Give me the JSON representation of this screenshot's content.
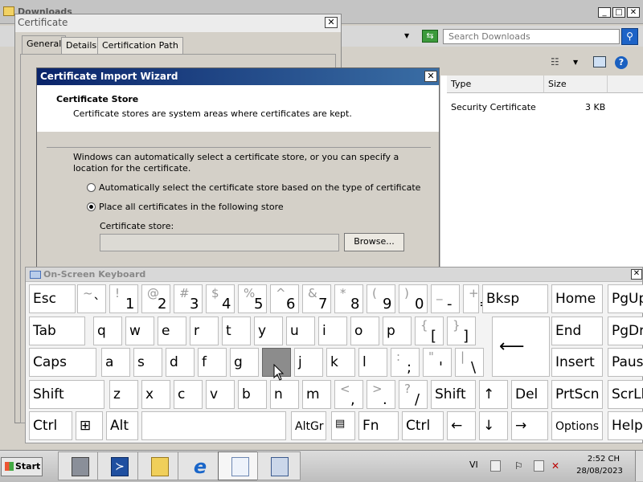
{
  "explorer": {
    "title": "Downloads",
    "search_placeholder": "Search Downloads",
    "columns": [
      "Type",
      "Size"
    ],
    "files": [
      {
        "type": "Security Certificate",
        "size": "3 KB"
      }
    ]
  },
  "certificate_dialog": {
    "title": "Certificate",
    "tabs": [
      "General",
      "Details",
      "Certification Path"
    ],
    "active_tab": "General"
  },
  "wizard": {
    "title": "Certificate Import Wizard",
    "heading": "Certificate Store",
    "subheading": "Certificate stores are system areas where certificates are kept.",
    "description": "Windows can automatically select a certificate store, or you can specify a location for the certificate.",
    "option_auto": "Automatically select the certificate store based on the type of certificate",
    "option_manual": "Place all certificates in the following store",
    "selected_option": "manual",
    "store_label": "Certificate store:",
    "store_value": "",
    "browse_label": "Browse..."
  },
  "osk": {
    "title": "On-Screen Keyboard",
    "pressed_key": "h",
    "row1": [
      {
        "main": "Esc"
      },
      {
        "shift": "~",
        "main": "`"
      },
      {
        "shift": "!",
        "main": "1"
      },
      {
        "shift": "@",
        "main": "2"
      },
      {
        "shift": "#",
        "main": "3"
      },
      {
        "shift": "$",
        "main": "4"
      },
      {
        "shift": "%",
        "main": "5"
      },
      {
        "shift": "^",
        "main": "6"
      },
      {
        "shift": "&",
        "main": "7"
      },
      {
        "shift": "*",
        "main": "8"
      },
      {
        "shift": "(",
        "main": "9"
      },
      {
        "shift": ")",
        "main": "0"
      },
      {
        "shift": "_",
        "main": "-"
      },
      {
        "shift": "+",
        "main": "="
      },
      {
        "main": "Bksp"
      },
      {
        "main": "Home"
      },
      {
        "main": "PgUp"
      }
    ],
    "row2": [
      {
        "main": "Tab"
      },
      {
        "main": "q"
      },
      {
        "main": "w"
      },
      {
        "main": "e"
      },
      {
        "main": "r"
      },
      {
        "main": "t"
      },
      {
        "main": "y"
      },
      {
        "main": "u"
      },
      {
        "main": "i"
      },
      {
        "main": "o"
      },
      {
        "main": "p"
      },
      {
        "shift": "{",
        "main": "["
      },
      {
        "shift": "}",
        "main": "]"
      },
      {
        "main": "End"
      },
      {
        "main": "PgDn"
      }
    ],
    "row3": [
      {
        "main": "Caps"
      },
      {
        "main": "a"
      },
      {
        "main": "s"
      },
      {
        "main": "d"
      },
      {
        "main": "f"
      },
      {
        "main": "g"
      },
      {
        "main": ""
      },
      {
        "main": "j"
      },
      {
        "main": "k"
      },
      {
        "main": "l"
      },
      {
        "shift": ":",
        "main": ";"
      },
      {
        "shift": "\"",
        "main": "'"
      },
      {
        "shift": "|",
        "main": "\\"
      },
      {
        "main": "Insert"
      },
      {
        "main": "Pause"
      }
    ],
    "row4": [
      {
        "main": "Shift"
      },
      {
        "main": "z"
      },
      {
        "main": "x"
      },
      {
        "main": "c"
      },
      {
        "main": "v"
      },
      {
        "main": "b"
      },
      {
        "main": "n"
      },
      {
        "main": "m"
      },
      {
        "shift": "<",
        "main": ","
      },
      {
        "shift": ">",
        "main": "."
      },
      {
        "shift": "?",
        "main": "/"
      },
      {
        "main": "Shift"
      },
      {
        "main": "↑"
      },
      {
        "main": "Del"
      },
      {
        "main": "PrtScn"
      },
      {
        "main": "ScrLk"
      }
    ],
    "row5": [
      {
        "main": "Ctrl"
      },
      {
        "main": ""
      },
      {
        "main": "Alt"
      },
      {
        "main": ""
      },
      {
        "main": "AltGr"
      },
      {
        "main": ""
      },
      {
        "main": "Fn"
      },
      {
        "main": "Ctrl"
      },
      {
        "main": "←"
      },
      {
        "main": "↓"
      },
      {
        "main": "→"
      },
      {
        "main": "Options"
      },
      {
        "main": "Help"
      }
    ],
    "enter_symbol": "⟵"
  },
  "taskbar": {
    "start_label": "Start",
    "language": "VI",
    "time": "2:52 CH",
    "date": "28/08/2023"
  }
}
